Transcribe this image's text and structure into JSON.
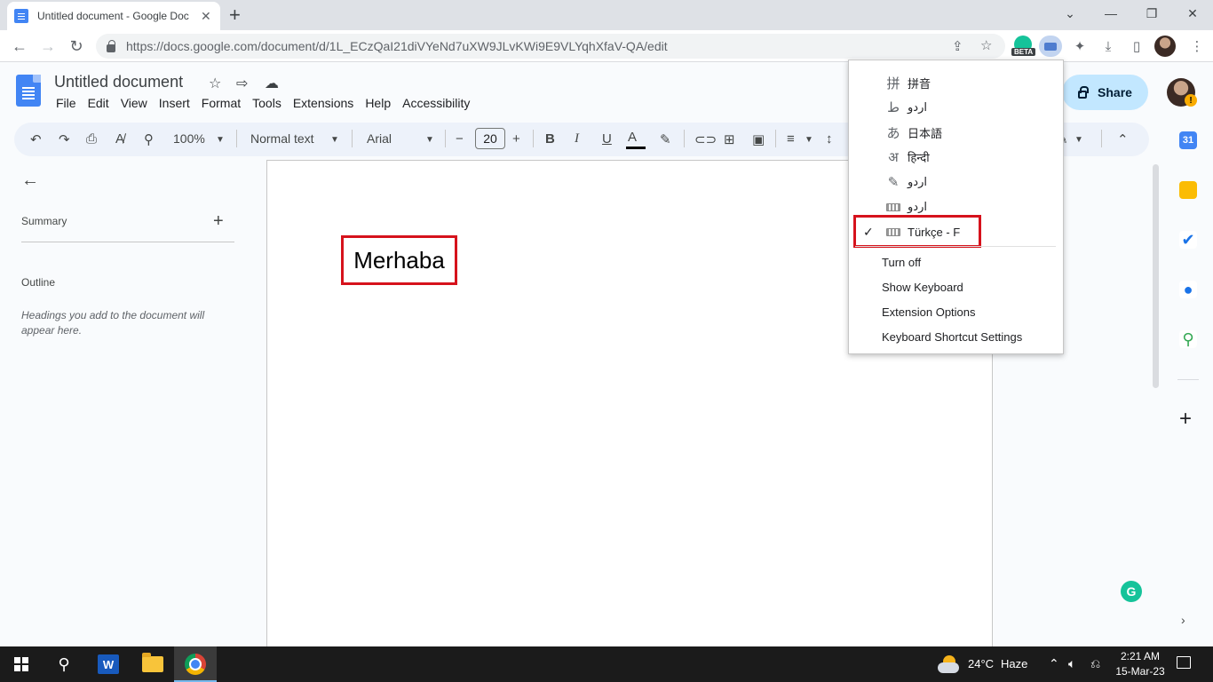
{
  "browser": {
    "tab_title": "Untitled document - Google Doc",
    "tab_close": "✕",
    "new_tab": "+",
    "window_controls": [
      "⌄",
      "—",
      "❐",
      "✕"
    ],
    "url": "https://docs.google.com/document/d/1L_ECzQaI21diVYeNd7uXW9JLvKWi9E9VLYqhXfaV-QA/edit",
    "beta_label": "BETA"
  },
  "docs": {
    "title": "Untitled document",
    "menu": [
      "File",
      "Edit",
      "View",
      "Insert",
      "Format",
      "Tools",
      "Extensions",
      "Help",
      "Accessibility"
    ],
    "share_label": "Share"
  },
  "format_toolbar": {
    "zoom": "100%",
    "style": "Normal text",
    "font": "Arial",
    "font_size": "20",
    "bold": "B",
    "italic": "I",
    "underline": "U",
    "text_color": "A"
  },
  "outline_panel": {
    "summary_label": "Summary",
    "outline_label": "Outline",
    "hint": "Headings you add to the document will appear here."
  },
  "document": {
    "body_text": "Merhaba"
  },
  "input_tools_menu": {
    "languages": [
      {
        "icon": "拼",
        "label": "拼音"
      },
      {
        "icon": "ط",
        "label": "اردو"
      },
      {
        "icon": "あ",
        "label": "日本語"
      },
      {
        "icon": "अ",
        "label": "हिन्दी"
      },
      {
        "icon": "✎",
        "label": "اردو"
      },
      {
        "icon": "keyboard-icon",
        "label": "اردو"
      },
      {
        "icon": "keyboard-icon",
        "label": "Türkçe - F",
        "selected": true
      }
    ],
    "actions": [
      "Turn off",
      "Show Keyboard",
      "Extension Options",
      "Keyboard Shortcut Settings"
    ]
  },
  "side_panel": {
    "calendar_day": "31",
    "add": "+",
    "grammarly": "G"
  },
  "taskbar": {
    "temperature": "24°C",
    "weather": "Haze",
    "time": "2:21 AM",
    "date": "15-Mar-23",
    "word_letter": "W"
  },
  "colors": {
    "accent_blue": "#4285f4",
    "highlight_red": "#d6121c",
    "share_bg": "#c2e7ff"
  }
}
